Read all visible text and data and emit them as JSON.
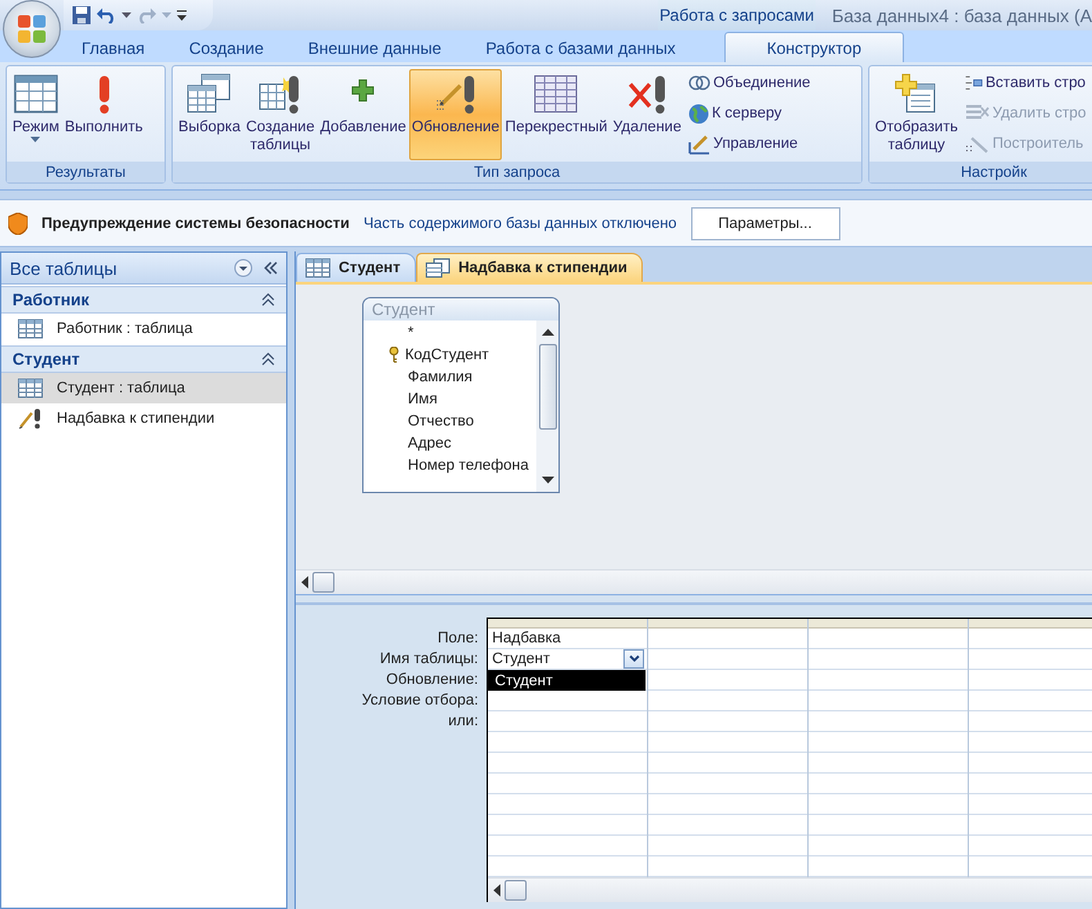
{
  "title_bar": {
    "context_label": "Работа с запросами",
    "title": "База данных4 : база данных (A"
  },
  "ribbon_tabs": [
    {
      "label": "Главная",
      "selected": false
    },
    {
      "label": "Создание",
      "selected": false
    },
    {
      "label": "Внешние данные",
      "selected": false
    },
    {
      "label": "Работа с базами данных",
      "selected": false
    },
    {
      "label": "Конструктор",
      "selected": true
    }
  ],
  "ribbon_groups": [
    {
      "label": "Результаты",
      "buttons": [
        {
          "label": "Режим",
          "kind": "large_menu",
          "selected": false,
          "disabled": false
        },
        {
          "label": "Выполнить",
          "kind": "large",
          "selected": false,
          "disabled": false
        }
      ]
    },
    {
      "label": "Тип запроса",
      "buttons": [
        {
          "label": "Выборка",
          "kind": "large",
          "selected": false,
          "disabled": false
        },
        {
          "label": "Создание таблицы",
          "kind": "large",
          "selected": false,
          "disabled": false
        },
        {
          "label": "Добавление",
          "kind": "large",
          "selected": false,
          "disabled": false
        },
        {
          "label": "Обновление",
          "kind": "large",
          "selected": true,
          "disabled": false
        },
        {
          "label": "Перекрестный",
          "kind": "large",
          "selected": false,
          "disabled": false
        },
        {
          "label": "Удаление",
          "kind": "large",
          "selected": false,
          "disabled": false
        },
        {
          "label": "Объединение",
          "kind": "small",
          "selected": false,
          "disabled": false
        },
        {
          "label": "К серверу",
          "kind": "small",
          "selected": false,
          "disabled": false
        },
        {
          "label": "Управление",
          "kind": "small",
          "selected": false,
          "disabled": false
        }
      ]
    },
    {
      "label": "Настройк",
      "buttons": [
        {
          "label": "Отобразить таблицу",
          "kind": "large",
          "selected": false,
          "disabled": false
        },
        {
          "label": "Вставить стро",
          "kind": "small",
          "selected": false,
          "disabled": false
        },
        {
          "label": "Удалить стро",
          "kind": "small",
          "selected": false,
          "disabled": true
        },
        {
          "label": "Построитель",
          "kind": "small",
          "selected": false,
          "disabled": true
        }
      ]
    }
  ],
  "security_bar": {
    "title": "Предупреждение системы безопасности",
    "message": "Часть содержимого базы данных отключено",
    "button": "Параметры..."
  },
  "nav_pane": {
    "header": "Все таблицы",
    "groups": [
      {
        "label": "Работник",
        "expanded": true,
        "items": [
          {
            "label": "Работник : таблица",
            "kind": "table",
            "selected": false
          }
        ]
      },
      {
        "label": "Студент",
        "expanded": true,
        "items": [
          {
            "label": "Студент : таблица",
            "kind": "table",
            "selected": true
          },
          {
            "label": "Надбавка к стипендии",
            "kind": "query",
            "selected": false
          }
        ]
      }
    ]
  },
  "doc_tabs": [
    {
      "label": "Студент",
      "kind": "table",
      "selected": false
    },
    {
      "label": "Надбавка к стипендии",
      "kind": "query",
      "selected": true
    }
  ],
  "field_list": {
    "title": "Студент",
    "fields": [
      {
        "label": "*",
        "primary_key": false
      },
      {
        "label": "КодСтудент",
        "primary_key": true
      },
      {
        "label": "Фамилия",
        "primary_key": false
      },
      {
        "label": "Имя",
        "primary_key": false
      },
      {
        "label": "Отчество",
        "primary_key": false
      },
      {
        "label": "Адрес",
        "primary_key": false
      },
      {
        "label": "Номер телефона",
        "primary_key": false
      }
    ]
  },
  "grid": {
    "row_labels": [
      "Поле:",
      "Имя таблицы:",
      "Обновление:",
      "Условие отбора:",
      "или:"
    ],
    "columns": [
      {
        "field": "Надбавка",
        "table": "Студент"
      }
    ],
    "table_dropdown": {
      "options": [
        {
          "label": "Студент",
          "selected": true
        }
      ]
    }
  }
}
